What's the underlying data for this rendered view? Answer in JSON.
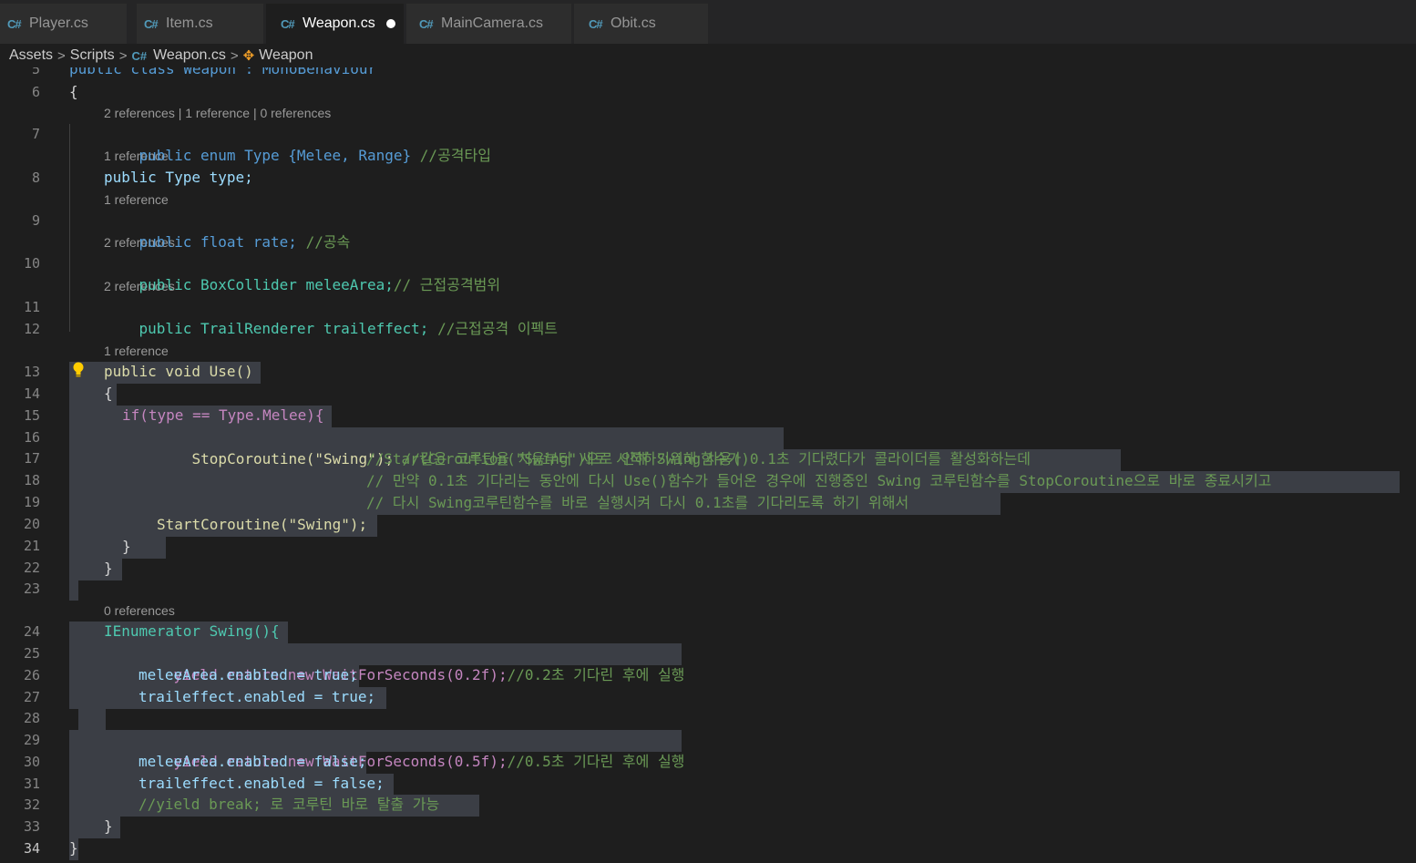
{
  "tabs": [
    {
      "icon": "C#",
      "label": "Player.cs"
    },
    {
      "icon": "C#",
      "label": "Item.cs"
    },
    {
      "icon": "C#",
      "label": "Weapon.cs"
    },
    {
      "icon": "C#",
      "label": "MainCamera.cs"
    },
    {
      "icon": "C#",
      "label": "Obit.cs"
    }
  ],
  "breadcrumb": {
    "items": [
      "Assets",
      "Scripts",
      "Weapon.cs",
      "Weapon"
    ],
    "separator": ">"
  },
  "editor": {
    "line_numbers": [
      "5",
      "6",
      "7",
      "8",
      "9",
      "10",
      "11",
      "12",
      "13",
      "14",
      "15",
      "16",
      "17",
      "18",
      "19",
      "20",
      "21",
      "22",
      "23",
      "24",
      "25",
      "26",
      "27",
      "28",
      "29",
      "30",
      "31",
      "32",
      "33",
      "34"
    ],
    "code_lens": {
      "l7": "2 references | 1 reference | 0 references",
      "l8": "1 reference",
      "l9": "1 reference",
      "l10": "2 references",
      "l11": "2 references",
      "l13": "1 reference",
      "l24": "0 references"
    },
    "lines": {
      "l5": "public class Weapon : MonoBehaviour",
      "l6": "{",
      "l7a": "public enum Type {Melee, Range}",
      "l7c": "//공격타입",
      "l8": "public Type type;",
      "l9a": "public float rate;",
      "l9c": "//공속",
      "l10a": "public BoxCollider meleeArea;",
      "l10c": "// 근접공격범위",
      "l11a": "public TrailRenderer traileffect;",
      "l11c": "//근접공격 이펙트",
      "l13": "public void Use()",
      "l14": "{",
      "l15": "if(type == Type.Melee){",
      "l16a": "StopCoroutine(\"Swing\");",
      "l16c": "//같은 코루틴을 처음부터 새로 시작하기위해 사용()",
      "l17c": "//StartCoroution(\"Swing\")으로 인해 Swing함수가 0.1초 기다렸다가 콜라이더를 활성화하는데",
      "l18c": "// 만약 0.1초 기다리는 동안에 다시 Use()함수가 들어온 경우에 진행중인 Swing 코루틴함수를 StopCoroutine으로 바로 종료시키고",
      "l19c": "// 다시 Swing코루틴함수를 바로 실행시켜 다시 0.1초를 기다리도록 하기 위해서",
      "l20": "StartCoroutine(\"Swing\");",
      "l21": "}",
      "l22": "}",
      "l24": "IEnumerator Swing(){",
      "l25a": "yield return new WaitForSeconds(0.2f);",
      "l25c": "//0.2초 기다린 후에 실행",
      "l26": "meleeArea.enabled = true;",
      "l27": "traileffect.enabled = true;",
      "l29a": "yield return new WaitForSeconds(0.5f);",
      "l29c": "//0.5초 기다린 후에 실행",
      "l30": "meleeArea.enabled = false;",
      "l31": "traileffect.enabled = false;",
      "l32": "//yield break; 로 코루틴 바로 탈출 가능",
      "l33": "}",
      "l34": "}"
    }
  },
  "colors": {
    "background": "#1e1e1e",
    "keyword": "#569cd6",
    "control_keyword": "#c586c0",
    "type": "#4ec9b0",
    "variable": "#9cdcfe",
    "function": "#dcdcaa",
    "string": "#ce9178",
    "number": "#b5cea8",
    "comment": "#6a9955",
    "selection": "#3b3e45",
    "csharp_icon": "#519aba"
  },
  "icons": {
    "tab_file": "csharp-file-icon",
    "dirty": "unsaved-dot-icon",
    "class": "class-symbol-icon",
    "lightbulb": "lightbulb-icon"
  }
}
